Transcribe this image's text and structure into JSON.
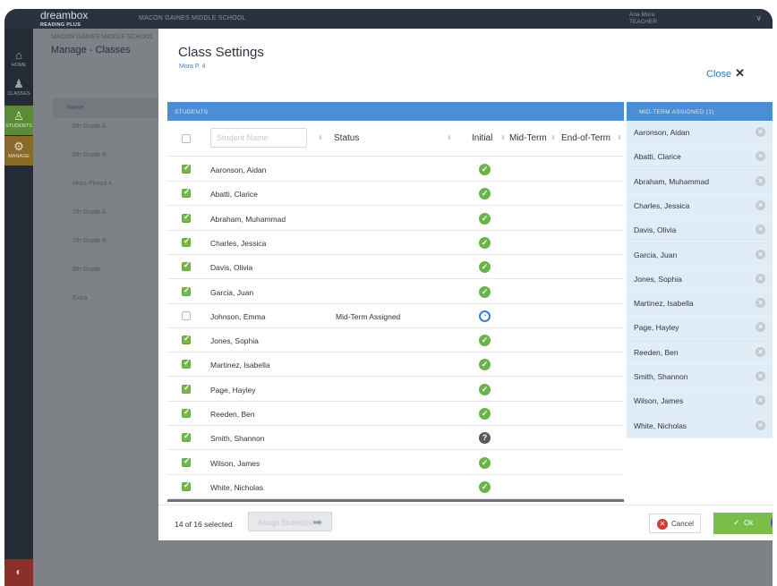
{
  "app": {
    "logo": "dreambox",
    "logo_sub": "READING PLUS",
    "school_top": "MACON GAINES MIDDLE SCHOOL",
    "user_name": "Ana Mora",
    "user_role": "TEACHER"
  },
  "nav": {
    "home": "HOME",
    "classes": "CLASSES",
    "students": "STUDENTS",
    "manage": "MANAGE"
  },
  "background": {
    "school": "MACON GAINES MIDDLE SCHOOL",
    "title": "Manage - Classes",
    "header": "Name",
    "classes": [
      "6th Grade A",
      "6th Grade B",
      "Mora Period 4",
      "7th Grade A",
      "7th Grade B",
      "8th Grade",
      "Extra"
    ]
  },
  "modal": {
    "title": "Class Settings",
    "subtitle": "Mora P. 4",
    "close_label": "Close",
    "students_section": "STUDENTS",
    "assigned_section": "MID-TERM ASSIGNED (1)",
    "columns": {
      "search_placeholder": "Student Name",
      "status": "Status",
      "initial": "Initial",
      "midterm": "Mid-Term",
      "endterm": "End-of-Term"
    },
    "students": [
      {
        "name": "Aaronson, Aidan",
        "checked": true,
        "status": "",
        "initial": "done"
      },
      {
        "name": "Abatti, Clarice",
        "checked": true,
        "status": "",
        "initial": "done"
      },
      {
        "name": "Abraham, Muhammad",
        "checked": true,
        "status": "",
        "initial": "done"
      },
      {
        "name": "Charles, Jessica",
        "checked": true,
        "status": "",
        "initial": "done"
      },
      {
        "name": "Davis, Olivia",
        "checked": true,
        "status": "",
        "initial": "done"
      },
      {
        "name": "Garcia, Juan",
        "checked": true,
        "status": "",
        "initial": "done"
      },
      {
        "name": "Johnson, Emma",
        "checked": false,
        "status": "Mid-Term Assigned",
        "initial": "partial"
      },
      {
        "name": "Jones, Sophia",
        "checked": true,
        "status": "",
        "initial": "done"
      },
      {
        "name": "Martinez, Isabella",
        "checked": true,
        "status": "",
        "initial": "done"
      },
      {
        "name": "Page, Hayley",
        "checked": true,
        "status": "",
        "initial": "done"
      },
      {
        "name": "Reeden, Ben",
        "checked": true,
        "status": "",
        "initial": "done"
      },
      {
        "name": "Smith, Shannon",
        "checked": true,
        "status": "",
        "initial": "unknown"
      },
      {
        "name": "Wilson, James",
        "checked": true,
        "status": "",
        "initial": "done"
      },
      {
        "name": "White, Nicholas",
        "checked": true,
        "status": "",
        "initial": "done"
      }
    ],
    "assigned": [
      "Aaronson, Aidan",
      "Abatti, Clarice",
      "Abraham, Muhammad",
      "Charles, Jessica",
      "Davis, Olivia",
      "Garcia, Juan",
      "Jones, Sophia",
      "Martinez, Isabella",
      "Page, Hayley",
      "Reeden, Ben",
      "Smith, Shannon",
      "Wilson, James",
      "White, Nicholas"
    ],
    "footer": {
      "selected": "14 of 16 selected",
      "assign_label": "Assign Student(s)",
      "cancel_label": "Cancel",
      "ok_label": "Ok"
    }
  },
  "colors": {
    "accent_blue": "#4a8fd6",
    "success_green": "#69b34a",
    "cancel_red": "#d23c30"
  },
  "icons": {
    "home": "home-icon",
    "classes": "classes-icon",
    "students": "student-icon",
    "manage": "gear-icon",
    "close": "close-icon",
    "done": "check-circle-icon",
    "partial": "progress-circle-icon",
    "unknown": "question-circle-icon",
    "remove": "remove-icon",
    "assign": "arrow-right-icon"
  }
}
